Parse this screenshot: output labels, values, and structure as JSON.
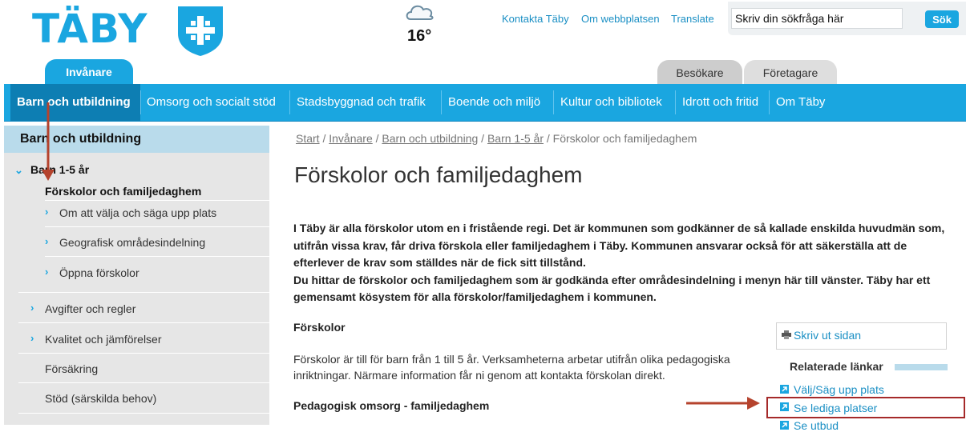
{
  "header": {
    "logo_text": "TÄBY",
    "weather_temp": "16°",
    "links": [
      "Kontakta Täby",
      "Om webbplatsen",
      "Translate"
    ],
    "search_placeholder": "Skriv din sökfråga här",
    "search_button": "Sök"
  },
  "audience_tabs": [
    "Invånare",
    "Besökare",
    "Företagare"
  ],
  "main_nav": [
    "Barn och utbildning",
    "Omsorg och socialt stöd",
    "Stadsbyggnad och trafik",
    "Boende och miljö",
    "Kultur och bibliotek",
    "Idrott och fritid",
    "Om Täby"
  ],
  "sidebar": {
    "title": "Barn och utbildning",
    "section": "Barn 1-5 år",
    "current": "Förskolor och familjedaghem",
    "sub_items": [
      "Om att välja och säga upp plats",
      "Geografisk områdesindelning",
      "Öppna förskolor"
    ],
    "items": [
      "Avgifter och regler",
      "Kvalitet och jämförelser",
      "Försäkring",
      "Stöd (särskilda behov)"
    ]
  },
  "breadcrumb": {
    "items": [
      "Start",
      "Invånare",
      "Barn och utbildning",
      "Barn 1-5 år"
    ],
    "current": "Förskolor och familjedaghem",
    "separator": " / "
  },
  "content": {
    "title": "Förskolor och familjedaghem",
    "intro_1": "I Täby är alla förskolor utom en i fristående regi. Det är kommunen som godkänner de så kallade enskilda huvudmän som, utifrån vissa krav, får driva förskola eller familjedaghem i Täby. Kommunen ansvarar också för att säkerställa att de efterlever de krav som ställdes när de fick sitt tillstånd.",
    "intro_2": "Du hittar de förskolor och familjedaghem som är godkända efter områdesindelning i menyn här till vänster. Täby har ett gemensamt kösystem för alla förskolor/familjedaghem i kommunen.",
    "heading_forskolor": "Förskolor",
    "text_forskolor": "Förskolor är till för barn från 1 till 5 år. Verksamheterna arbetar utifrån olika pedagogiska inriktningar. Närmare information får ni genom att kontakta förskolan direkt.",
    "heading_pedagogisk": "Pedagogisk omsorg - familjedaghem"
  },
  "aside": {
    "print_label": "Skriv ut sidan",
    "related_heading": "Relaterade länkar",
    "related_links": [
      "Välj/Säg upp plats",
      "Se lediga platser",
      "Se utbud"
    ]
  },
  "colors": {
    "brand_blue": "#1aa6e0",
    "nav_active": "#0d7eb3",
    "annotation_red": "#b5432d"
  }
}
